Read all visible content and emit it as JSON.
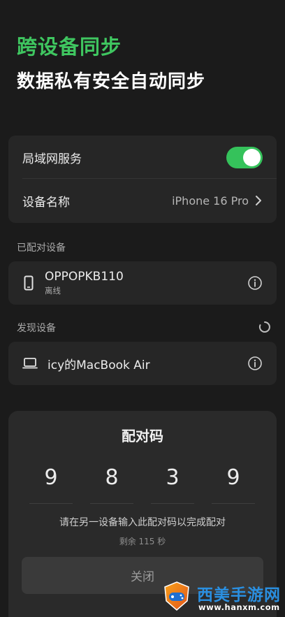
{
  "header": {
    "title": "跨设备同步",
    "subtitle": "数据私有安全自动同步"
  },
  "settings": {
    "lan_service_label": "局域网服务",
    "lan_service_enabled": true,
    "device_name_label": "设备名称",
    "device_name_value": "iPhone 16 Pro"
  },
  "paired": {
    "section_label": "已配对设备",
    "devices": [
      {
        "name": "OPPOPKB110",
        "status": "离线",
        "icon": "phone-icon"
      }
    ]
  },
  "discovered": {
    "section_label": "发现设备",
    "devices": [
      {
        "name": "icy的MacBook Air",
        "icon": "laptop-icon"
      }
    ]
  },
  "pairing_sheet": {
    "title": "配对码",
    "digits": [
      "9",
      "8",
      "3",
      "9"
    ],
    "description": "请在另一设备输入此配对码以完成配对",
    "timer": "剩余 115 秒",
    "close_label": "关闭"
  },
  "watermark": {
    "site_name": "西美手游网",
    "url": "www.hanxm.com"
  },
  "colors": {
    "accent_green": "#3fc660",
    "toggle_on": "#35c25b",
    "background": "#1b1b1b",
    "card": "#262626"
  }
}
